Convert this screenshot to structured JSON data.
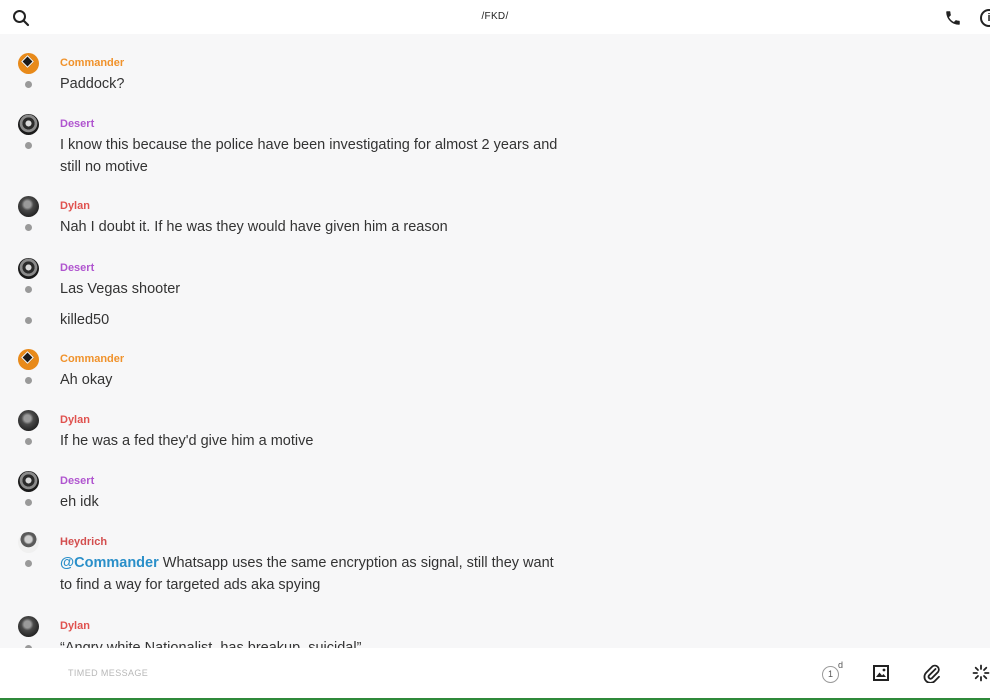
{
  "header": {
    "title": "/FKD/",
    "icons": {
      "search": "search-icon",
      "call": "phone-icon",
      "info": "info-icon"
    }
  },
  "colors": {
    "commander": "#f0922b",
    "desert": "#b055cf",
    "dylan": "#e0524f",
    "heydrich": "#d34e4e",
    "mention": "#2a8fc9"
  },
  "messages": [
    {
      "sender": "Commander",
      "lines": [
        "Paddock?"
      ]
    },
    {
      "sender": "Desert",
      "lines": [
        "I know this because the police have been investigating for almost 2 years and still no motive"
      ]
    },
    {
      "sender": "Dylan",
      "lines": [
        "Nah I doubt it. If he was they would have given him a reason"
      ]
    },
    {
      "sender": "Desert",
      "lines": [
        "Las Vegas shooter",
        "killed50"
      ]
    },
    {
      "sender": "Commander",
      "lines": [
        "Ah okay"
      ]
    },
    {
      "sender": "Dylan",
      "lines": [
        "If he was a fed they'd give him a motive"
      ]
    },
    {
      "sender": "Desert",
      "lines": [
        "eh idk"
      ]
    },
    {
      "sender": "Heydrich",
      "mention": "@Commander",
      "lines": [
        "Whatsapp uses the same encryption as signal, still they want to find a way for targeted ads aka spying"
      ]
    },
    {
      "sender": "Dylan",
      "lines": [
        "“Angry white Nationalist, has breakup, suicidal”"
      ]
    }
  ],
  "composer": {
    "placeholder": "TIMED MESSAGE",
    "timer_value": "1",
    "timer_unit": "d",
    "icons": {
      "timer": "timer-icon",
      "image": "image-icon",
      "attach": "paperclip-icon",
      "more": "loading-spinner-icon"
    }
  }
}
